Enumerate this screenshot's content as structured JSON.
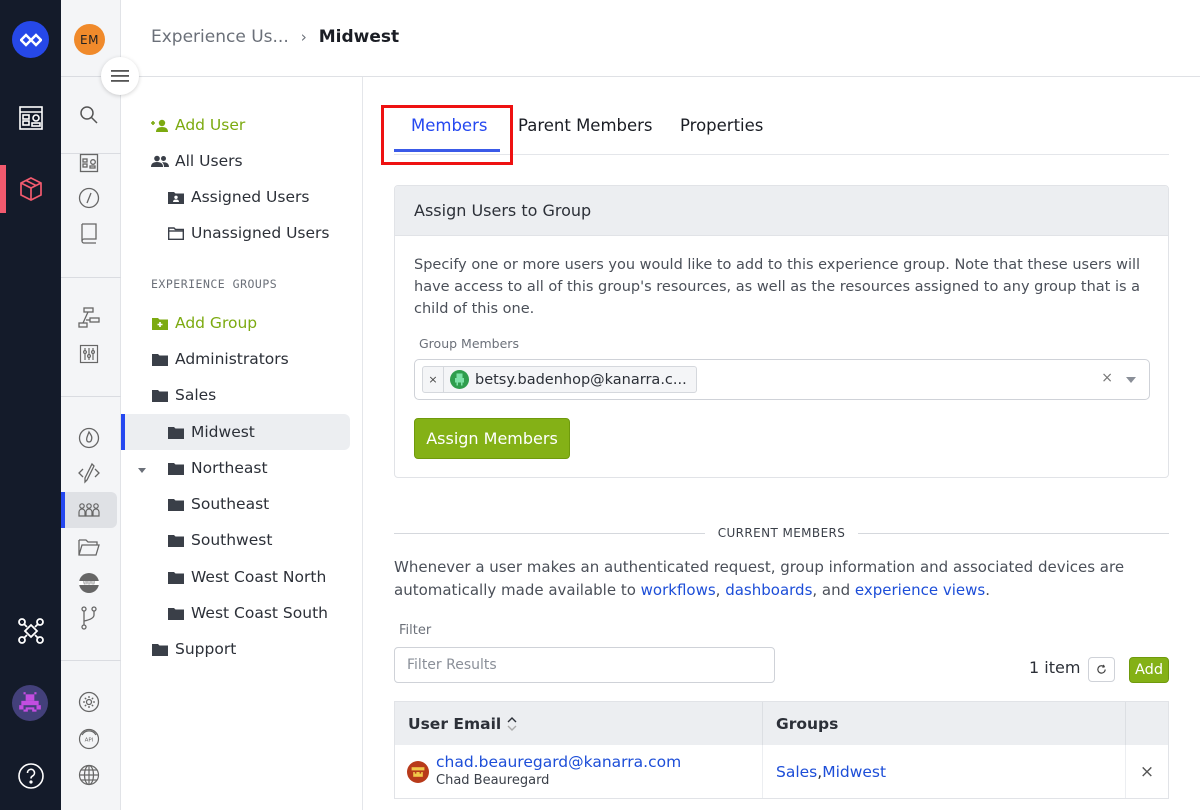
{
  "breadcrumb": {
    "parent": "Experience Us...",
    "separator": "›",
    "current": "Midwest"
  },
  "user_avatar_initials": "EM",
  "group_nav": {
    "add_user": "Add User",
    "all_users": "All Users",
    "assigned_users": "Assigned Users",
    "unassigned_users": "Unassigned Users",
    "section_title": "EXPERIENCE GROUPS",
    "add_group": "Add Group",
    "groups": [
      {
        "label": "Administrators",
        "level": 0
      },
      {
        "label": "Sales",
        "level": 0,
        "expanded": true
      },
      {
        "label": "Midwest",
        "level": 1,
        "selected": true
      },
      {
        "label": "Northeast",
        "level": 1
      },
      {
        "label": "Southeast",
        "level": 1
      },
      {
        "label": "Southwest",
        "level": 1
      },
      {
        "label": "West Coast North",
        "level": 1
      },
      {
        "label": "West Coast South",
        "level": 1
      },
      {
        "label": "Support",
        "level": 0
      }
    ]
  },
  "tabs": [
    {
      "label": "Members",
      "active": true
    },
    {
      "label": "Parent Members",
      "active": false
    },
    {
      "label": "Properties",
      "active": false
    }
  ],
  "assign_card": {
    "title": "Assign Users to Group",
    "description": "Specify one or more users you would like to add to this experience group. Note that these users will have access to all of this group's resources, as well as the resources assigned to any group that is a child of this one.",
    "field_label": "Group Members",
    "selected_chips": [
      "betsy.badenhop@kanarra.c..."
    ],
    "clear_symbol": "×",
    "chip_remove_symbol": "×",
    "button_label": "Assign Members"
  },
  "current_members": {
    "divider_label": "CURRENT MEMBERS",
    "desc_prefix": "Whenever a user makes an authenticated request, group information and associated devices are automatically made available to ",
    "link_workflows": "workflows",
    "sep1": ", ",
    "link_dashboards": "dashboards",
    "sep2": ", and ",
    "link_views": "experience views",
    "desc_suffix": ".",
    "filter_label": "Filter",
    "filter_placeholder": "Filter Results",
    "filter_value": "",
    "item_count": "1 item",
    "add_button": "Add",
    "table": {
      "columns": [
        "User Email",
        "Groups",
        ""
      ],
      "rows": [
        {
          "email": "chad.beauregard@kanarra.com",
          "name": "Chad Beauregard",
          "groups": [
            "Sales",
            "Midwest"
          ],
          "group_sep": ", ",
          "remove_symbol": "×"
        }
      ]
    }
  },
  "colors": {
    "accent_blue": "#2548f0",
    "brand_green": "#84b116",
    "highlight_red": "#ee1111",
    "rail_dark": "#141b2a"
  }
}
